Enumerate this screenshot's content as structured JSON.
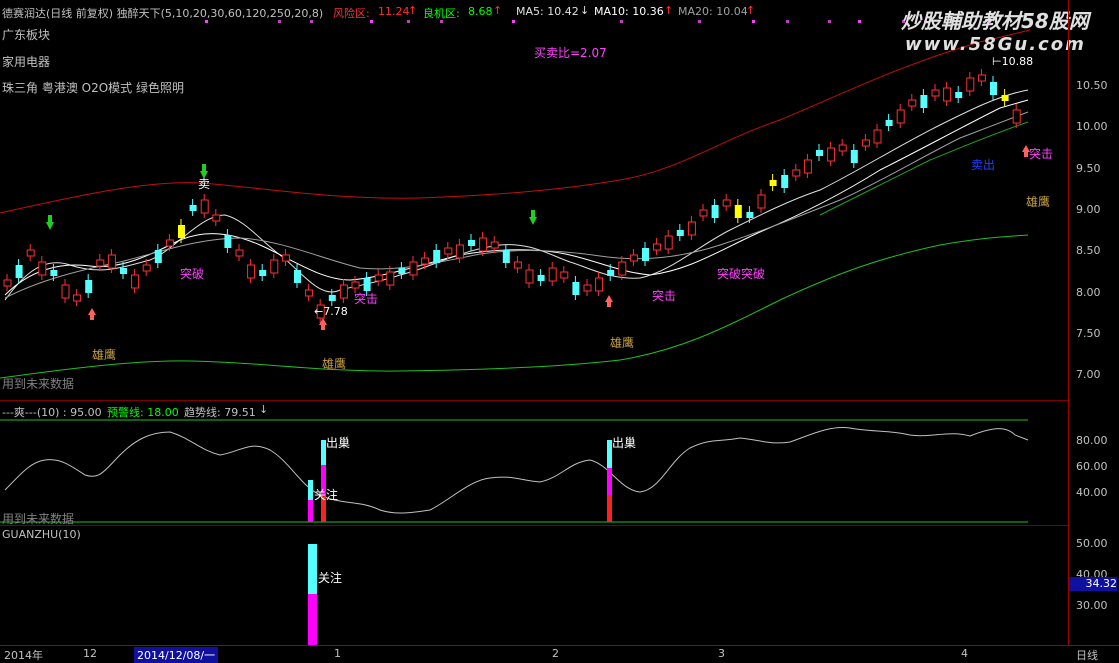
{
  "header": {
    "indicator_name": "德赛润达(日线 前复权) 独醉天下(5,10,20,30,60,120,250,20,8)",
    "risk_label": "风险区:",
    "risk_value": "11.24",
    "opp_label": "良机区:",
    "opp_value": "8.68",
    "ma5": "MA5: 10.42",
    "ma10": "MA10: 10.36",
    "ma20": "MA20: 10.04"
  },
  "sector_lines": [
    "广东板块",
    "家用电器",
    "珠三角 粤港澳 O2O模式 绿色照明"
  ],
  "watermark": {
    "title": "炒股輔助教材58股网",
    "url": "www.58Gu.com"
  },
  "buy_sell_ratio": "买卖比=2.07",
  "main_annotations": {
    "sell": "卖",
    "breakthrough": "突破",
    "attack": "突击",
    "hawk": "雄鹰",
    "breakthrough_double": "突破突破",
    "low_price": "7.78",
    "high_price": "10.88",
    "sell_bottom": "卖出",
    "future_data": "用到未来数据"
  },
  "indicator_pane": {
    "title": "---爽---(10) : 95.00",
    "warn_line": "预警线: 18.00",
    "trend_line": "趋势线: 79.51",
    "exit_label": "出巢",
    "focus_label": "关注",
    "future_data": "用到未来数据"
  },
  "guanzhu_pane": {
    "title": "GUANZHU(10)",
    "focus_label": "关注",
    "current_value": "34.32"
  },
  "price_axis": [
    "10.50",
    "10.00",
    "9.50",
    "9.00",
    "8.50",
    "8.00",
    "7.50",
    "7.00"
  ],
  "ind_axis": [
    "80.00",
    "60.00",
    "40.00"
  ],
  "gz_axis": [
    "50.00",
    "40.00",
    "30.00"
  ],
  "timeline": {
    "year": "2014年",
    "m12": "12",
    "cursor_date": "2014/12/08/一",
    "m1": "1",
    "m2": "2",
    "m3": "3",
    "m4": "4",
    "period": "日线"
  },
  "colors": {
    "risk": "#ff3030",
    "opportunity": "#00ff00",
    "up_candle": "#ff3030",
    "down_candle": "#54ffff",
    "yellow_candle": "#ffff00",
    "magenta": "#ff00ff"
  }
}
